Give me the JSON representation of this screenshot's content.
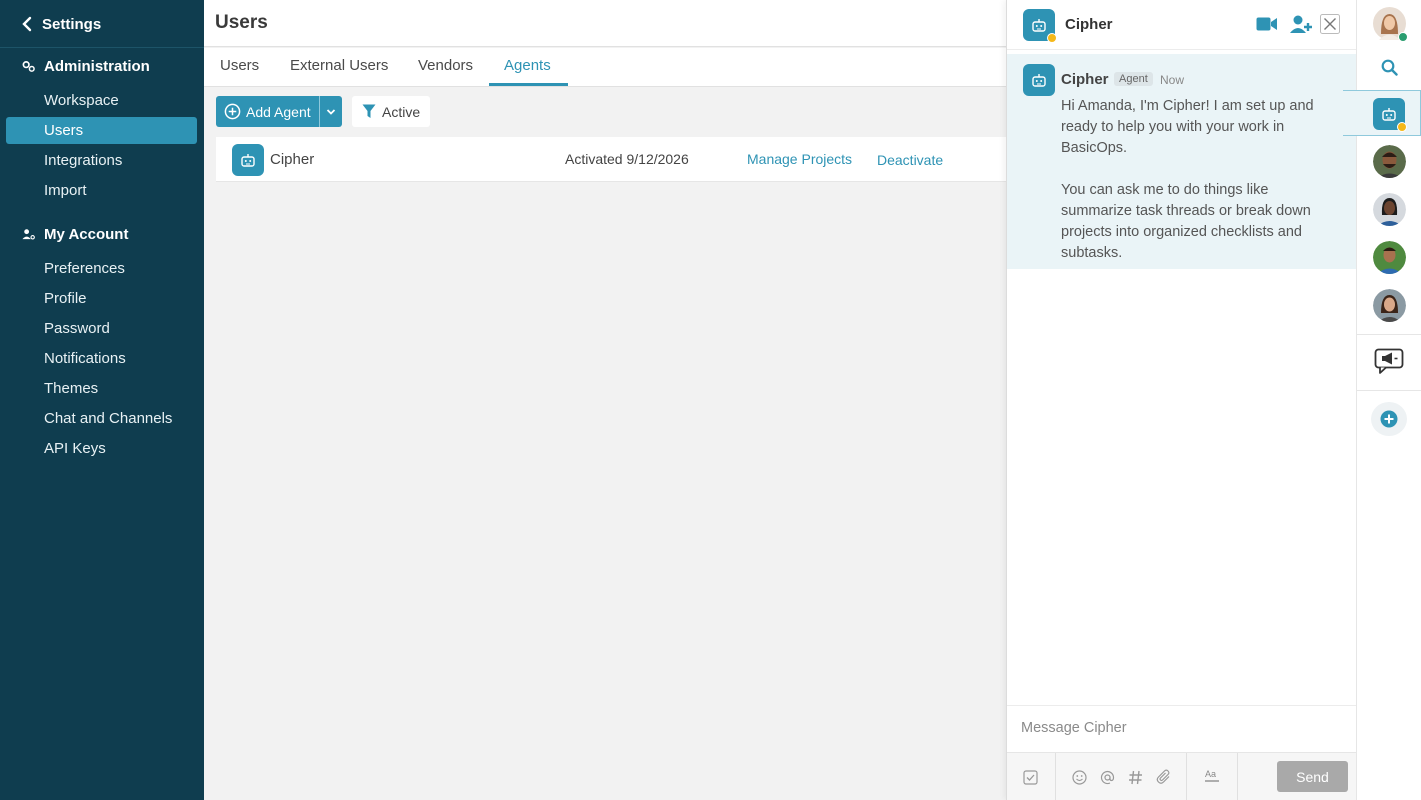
{
  "sidebar": {
    "back_label": "Settings",
    "sections": [
      {
        "title": "Administration",
        "items": [
          "Workspace",
          "Users",
          "Integrations",
          "Import"
        ]
      },
      {
        "title": "My Account",
        "items": [
          "Preferences",
          "Profile",
          "Password",
          "Notifications",
          "Themes",
          "Chat and Channels",
          "API Keys"
        ]
      }
    ],
    "active_item": "Users"
  },
  "main": {
    "title": "Users",
    "tabs": [
      "Users",
      "External Users",
      "Vendors",
      "Agents"
    ],
    "active_tab": "Agents",
    "add_button_label": "Add Agent",
    "filter_label": "Active",
    "agents": [
      {
        "name": "Cipher",
        "status": "Activated 9/12/2026",
        "action_manage": "Manage Projects",
        "action_deactivate": "Deactivate"
      }
    ]
  },
  "chat": {
    "title": "Cipher",
    "message": {
      "author": "Cipher",
      "badge": "Agent",
      "time": "Now",
      "paragraph1": "Hi Amanda, I'm Cipher! I am set up and ready to help you with your work in BasicOps.",
      "paragraph2": "You can ask me to do things like summarize task threads or break down projects into organized checklists and subtasks."
    },
    "input_placeholder": "Message Cipher",
    "send_label": "Send"
  },
  "colors": {
    "sidebar_bg": "#0f3d4f",
    "accent": "#2e93b4",
    "status_away": "#f5b819",
    "status_online": "#2a9d6f"
  }
}
